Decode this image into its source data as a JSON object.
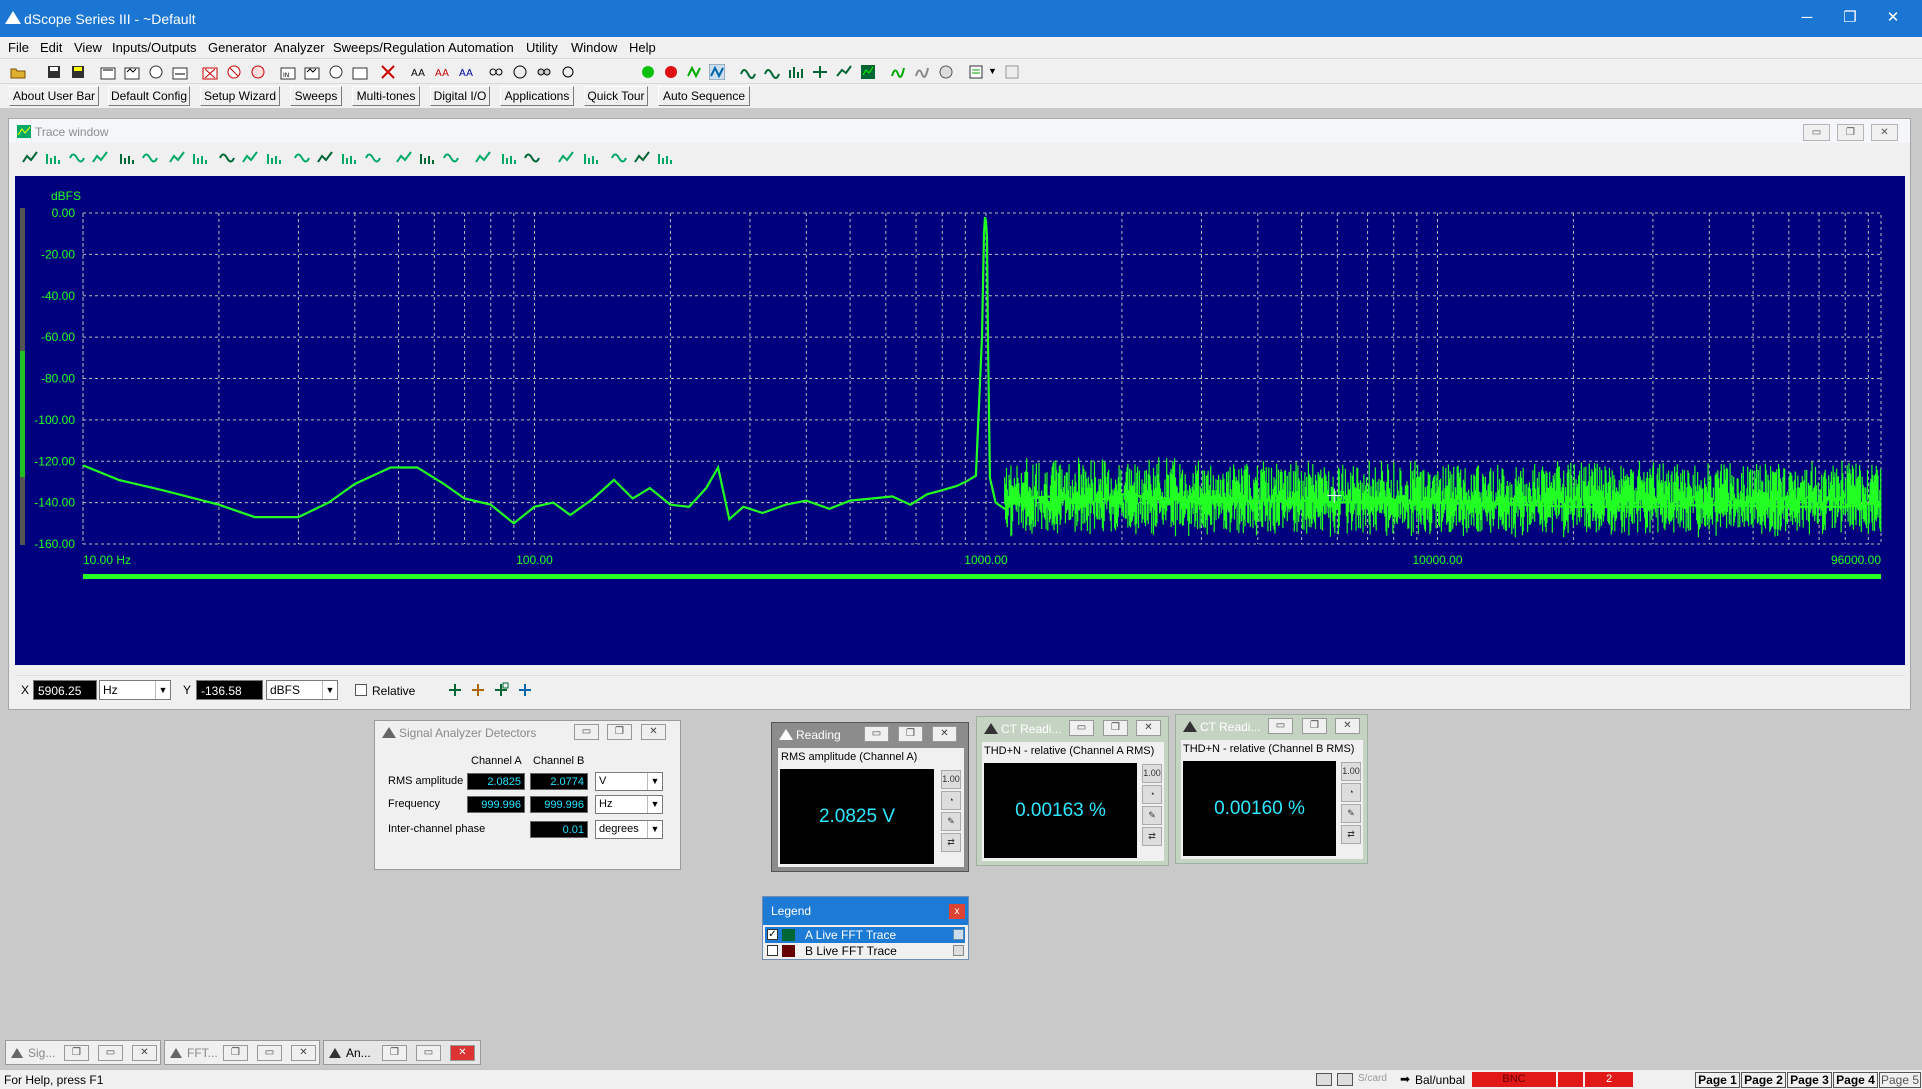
{
  "window": {
    "title": "dScope Series III - ~Default",
    "controls": [
      "─",
      "❐",
      "✕"
    ]
  },
  "menu": [
    "File",
    "Edit",
    "View",
    "Inputs/Outputs",
    "Generator",
    "Analyzer",
    "Sweeps/Regulation",
    "Automation",
    "Utility",
    "Window",
    "Help"
  ],
  "user_bar": [
    "About User Bar",
    "Default Config",
    "Setup Wizard",
    "Sweeps",
    "Multi-tones",
    "Digital I/O",
    "Applications",
    "Quick Tour",
    "Auto Sequence"
  ],
  "trace_window": {
    "title": "Trace window",
    "cursor": {
      "x_label": "X",
      "x_value": "5906.25",
      "x_unit": "Hz",
      "y_label": "Y",
      "y_value": "-136.58",
      "y_unit": "dBFS",
      "relative_label": "Relative"
    }
  },
  "chart_data": {
    "type": "line",
    "ylabel": "dBFS",
    "y_scale": "linear",
    "x_scale": "log",
    "xlim": [
      10,
      96000
    ],
    "ylim": [
      -160,
      0
    ],
    "y_ticks": [
      "0.00",
      "-20.00",
      "-40.00",
      "-60.00",
      "-80.00",
      "-100.00",
      "-120.00",
      "-140.00",
      "-160.00"
    ],
    "x_ticks": [
      "10.00 Hz",
      "100.00",
      "1000.00",
      "10000.00",
      "96000.00"
    ],
    "grid": true,
    "background": "#00007e",
    "series": [
      {
        "name": "A Live FFT Trace",
        "color": "#22ff22",
        "x": [
          10,
          12,
          15,
          20,
          24,
          30,
          35,
          40,
          48,
          55,
          63,
          70,
          80,
          90,
          100,
          110,
          120,
          135,
          150,
          165,
          180,
          200,
          220,
          240,
          255,
          270,
          290,
          320,
          360,
          400,
          450,
          500,
          560,
          620,
          680,
          740,
          800,
          860,
          900,
          950,
          980,
          990,
          995,
          1000,
          1005,
          1010,
          1020,
          1050,
          1100,
          1200,
          1400,
          1700,
          2000,
          2500,
          3000,
          4000,
          5000,
          6000,
          8000,
          10000,
          15000,
          20000,
          30000,
          40000,
          60000,
          80000,
          96000
        ],
        "values": [
          -122,
          -129,
          -134,
          -141,
          -147,
          -147,
          -140,
          -131,
          -123,
          -123,
          -131,
          -138,
          -141,
          -150,
          -142,
          -140,
          -146,
          -138,
          -129,
          -138,
          -133,
          -141,
          -142,
          -133,
          -123,
          -148,
          -142,
          -145,
          -141,
          -139,
          -143,
          -139,
          -138,
          -137,
          -141,
          -136,
          -134,
          -132,
          -130,
          -127,
          -60,
          -10,
          -2,
          -4,
          -12,
          -62,
          -128,
          -140,
          -143,
          -138,
          -137,
          -140,
          -136,
          -138,
          -140,
          -139,
          -139,
          -140,
          -139,
          -140,
          -141,
          -142,
          -142,
          -141,
          -142,
          -142,
          -140
        ]
      },
      {
        "name": "B Live FFT Trace",
        "color": "#ff4040",
        "x": [],
        "values": []
      }
    ]
  },
  "signal_analyzer": {
    "title": "Signal Analyzer Detectors",
    "col_a": "Channel A",
    "col_b": "Channel B",
    "rows": [
      {
        "label": "RMS amplitude",
        "a": "2.0825",
        "b": "2.0774",
        "unit": "V"
      },
      {
        "label": "Frequency",
        "a": "999.996",
        "b": "999.996",
        "unit": "Hz"
      },
      {
        "label": "Inter-channel phase",
        "a": "",
        "b": "0.01",
        "unit": "degrees"
      }
    ]
  },
  "reading": {
    "title": "Reading",
    "label": "RMS amplitude (Channel A)",
    "value": "2.0825 V"
  },
  "ct_a": {
    "title": "CT Readi...",
    "label": "THD+N - relative (Channel A RMS)",
    "value": "0.00163 %"
  },
  "ct_b": {
    "title": "CT Readi...",
    "label": "THD+N - relative (Channel B RMS)",
    "value": "0.00160 %"
  },
  "legend": {
    "title": "Legend",
    "items": [
      {
        "label": "A  Live FFT Trace",
        "checked": true,
        "color": "#22ff22"
      },
      {
        "label": "B  Live FFT Trace",
        "checked": false,
        "color": "#ff3030"
      }
    ]
  },
  "taskbar": [
    "Sig...",
    "FFT...",
    "An..."
  ],
  "status": {
    "help": "For Help, press F1",
    "items": [
      "S/card",
      "Bal/unbal",
      "BNC",
      "2"
    ],
    "pages": [
      "Page 1",
      "Page 2",
      "Page 3",
      "Page 4",
      "Page 5"
    ]
  },
  "colors": {
    "title_blue": "#1a76d2",
    "plot_bg": "#00007e",
    "trace_green": "#22ff22",
    "reading_cyan": "#2ee8ff"
  }
}
